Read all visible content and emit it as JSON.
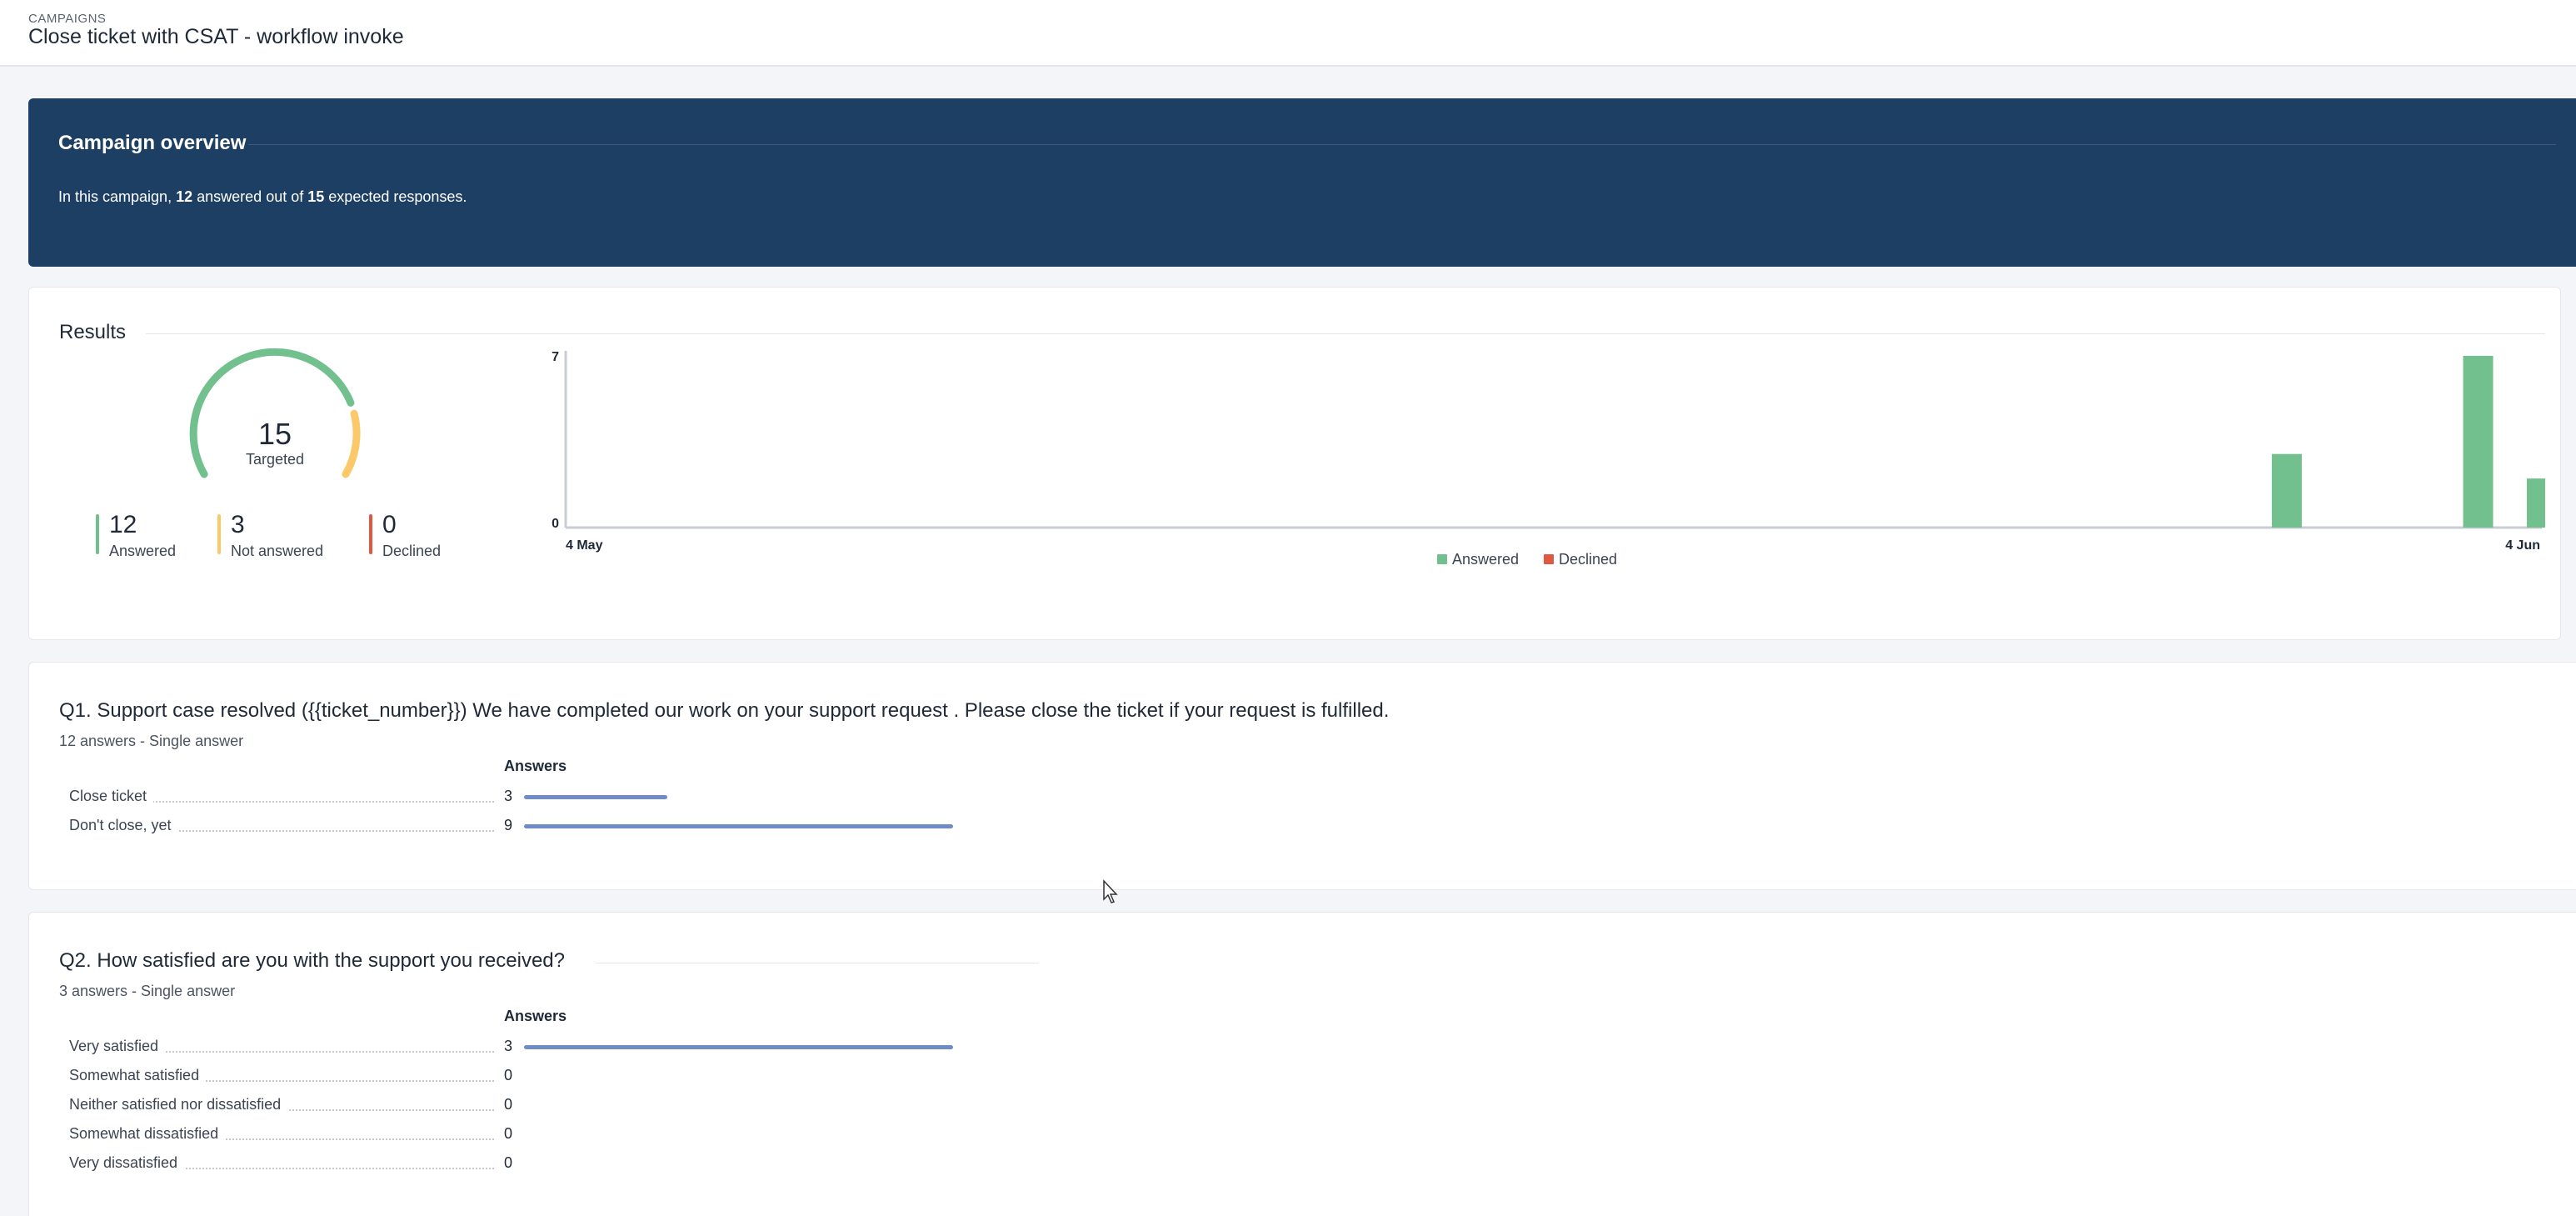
{
  "header": {
    "breadcrumb": "CAMPAIGNS",
    "title": "Close ticket with CSAT - workflow invoke"
  },
  "overview": {
    "title": "Campaign overview",
    "text_prefix": "In this campaign,",
    "answered": "12",
    "text_middle": "answered out of",
    "expected": "15",
    "text_suffix": "expected responses."
  },
  "results": {
    "title": "Results",
    "gauge": {
      "total": "15",
      "label": "Targeted",
      "answered_fraction": 0.8
    },
    "stats": [
      {
        "value": "12",
        "label": "Answered",
        "color": "#73c08f"
      },
      {
        "value": "3",
        "label": "Not answered",
        "color": "#fbc96a"
      },
      {
        "value": "0",
        "label": "Declined",
        "color": "#e0583f"
      }
    ]
  },
  "chart_data": {
    "type": "bar",
    "x_start": "4 May",
    "x_end": "4 Jun",
    "x_ticks": [
      "4 May",
      "4 Jun"
    ],
    "y_ticks": [
      "0",
      "7"
    ],
    "ylim": [
      0,
      7
    ],
    "series": [
      {
        "name": "Answered",
        "color": "#73c08f",
        "points": [
          {
            "day": 27,
            "value": 3
          },
          {
            "day": 30,
            "value": 7
          },
          {
            "day": 31,
            "value": 2
          }
        ]
      },
      {
        "name": "Declined",
        "color": "#e0583f",
        "points": []
      }
    ],
    "legend": "bottom-center"
  },
  "questions": [
    {
      "title": "Q1. Support case resolved ({{ticket_number}}) We have completed our work on your support request . Please close the ticket if your request is fulfilled.",
      "subtitle": "12 answers - Single answer",
      "column": "Answers",
      "max": 9,
      "options": [
        {
          "label": "Close ticket",
          "value": 3
        },
        {
          "label": "Don't close, yet",
          "value": 9
        }
      ]
    },
    {
      "title": "Q2. How satisfied are you with the support you received?",
      "subtitle": "3 answers - Single answer",
      "column": "Answers",
      "max": 3,
      "options": [
        {
          "label": "Very satisfied",
          "value": 3
        },
        {
          "label": "Somewhat satisfied",
          "value": 0
        },
        {
          "label": "Neither satisfied nor dissatisfied",
          "value": 0
        },
        {
          "label": "Somewhat dissatisfied",
          "value": 0
        },
        {
          "label": "Very dissatisfied",
          "value": 0
        }
      ]
    }
  ]
}
